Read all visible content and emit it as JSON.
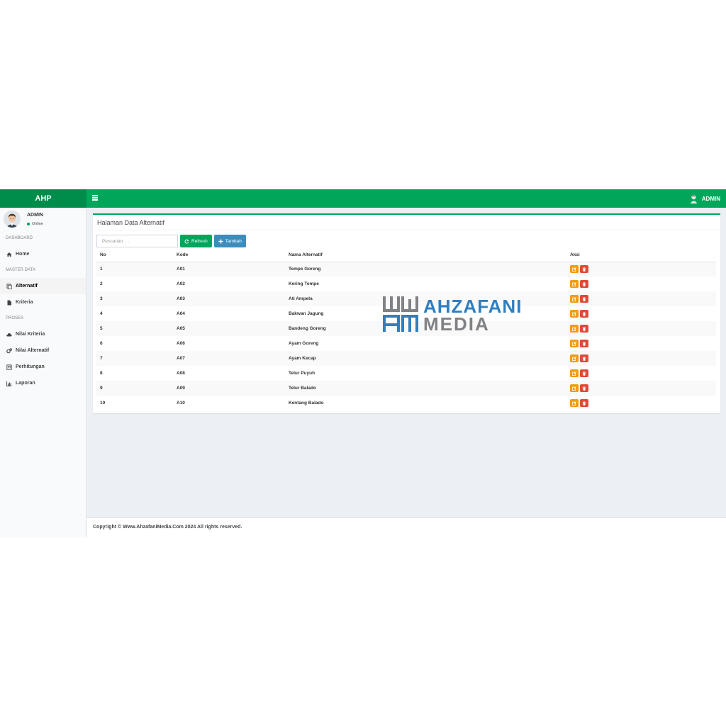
{
  "app": {
    "brand": "AHP",
    "user": "ADMIN"
  },
  "sidebar": {
    "user": {
      "name": "ADMIN",
      "status": "Online"
    },
    "sections": [
      {
        "header": "DASHBOARD",
        "items": [
          {
            "label": "Home",
            "icon": "home-icon"
          }
        ]
      },
      {
        "header": "MASTER DATA",
        "items": [
          {
            "label": "Alternatif",
            "icon": "copy-icon",
            "active": true
          },
          {
            "label": "Kriteria",
            "icon": "file-icon"
          }
        ]
      },
      {
        "header": "PROSES",
        "items": [
          {
            "label": "Nilai Kriteria",
            "icon": "cloud-icon"
          },
          {
            "label": "Nilai Alternatif",
            "icon": "cogs-icon"
          },
          {
            "label": "Perhitungan",
            "icon": "calculator-icon"
          },
          {
            "label": "Laporan",
            "icon": "bar-chart-icon"
          }
        ]
      }
    ]
  },
  "main": {
    "box_title": "Halaman Data Alternatif",
    "search_placeholder": "Pencarian. . .",
    "refresh_label": "Refresh",
    "add_label": "Tambah",
    "table": {
      "headers": [
        "No",
        "Kode",
        "Nama Alternatif",
        "Aksi"
      ],
      "rows": [
        [
          "1",
          "A01",
          "Tempe Goreng"
        ],
        [
          "2",
          "A02",
          "Kering Tempe"
        ],
        [
          "3",
          "A03",
          "Ati Ampela"
        ],
        [
          "4",
          "A04",
          "Bakwan Jagung"
        ],
        [
          "5",
          "A05",
          "Bandeng Goreng"
        ],
        [
          "6",
          "A06",
          "Ayam Goreng"
        ],
        [
          "7",
          "A07",
          "Ayam Kecap"
        ],
        [
          "8",
          "A08",
          "Telur Puyuh"
        ],
        [
          "9",
          "A09",
          "Telur Balado"
        ],
        [
          "10",
          "A10",
          "Kentang Balado"
        ]
      ]
    }
  },
  "footer": {
    "text": "Copyright © Www.AhzafaniMedia.Com 2024 All rights reserved."
  },
  "watermark": {
    "line1": "AHZAFANI",
    "line2": "MEDIA"
  },
  "colors": {
    "primary": "#00a65a",
    "primary_dark": "#008d4c",
    "info": "#3c8dbc",
    "warning": "#f39c12",
    "danger": "#dd4b39"
  }
}
